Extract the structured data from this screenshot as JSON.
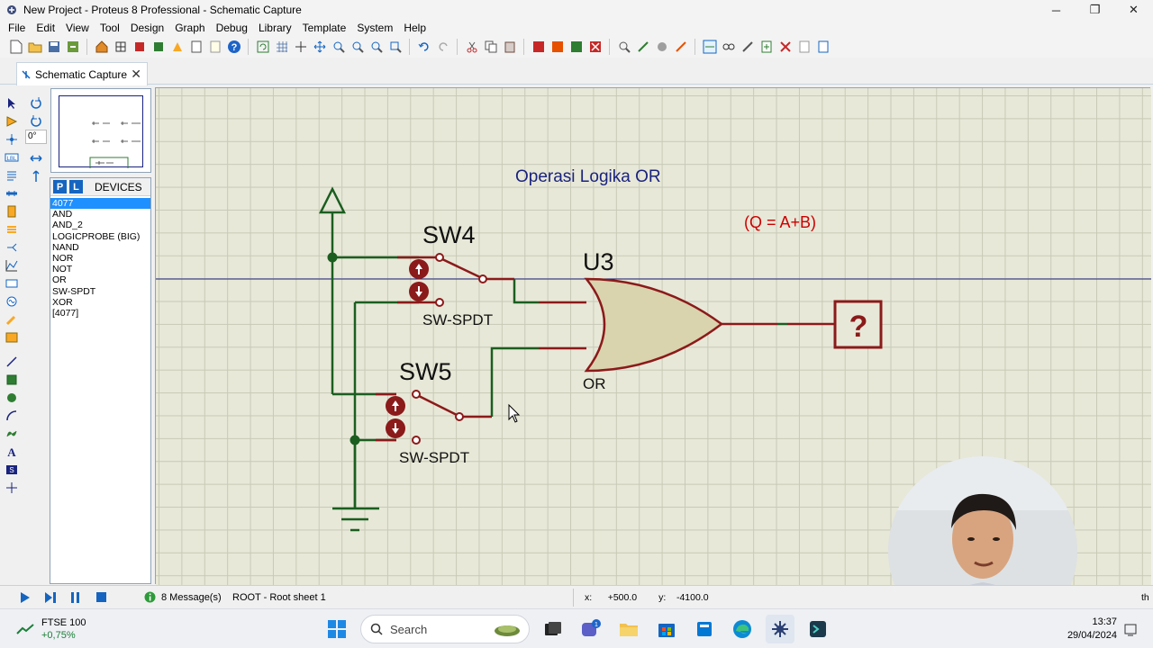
{
  "window": {
    "title": "New Project - Proteus 8 Professional - Schematic Capture",
    "minimize": "─",
    "maximize": "❐",
    "close": "✕"
  },
  "menu": [
    "File",
    "Edit",
    "View",
    "Tool",
    "Design",
    "Graph",
    "Debug",
    "Library",
    "Template",
    "System",
    "Help"
  ],
  "tab": {
    "label": "Schematic Capture",
    "close": "✕"
  },
  "rotation": {
    "angle": "0°"
  },
  "devices": {
    "p_label": "P",
    "l_label": "L",
    "title": "DEVICES",
    "items": [
      "4077",
      "AND",
      "AND_2",
      "LOGICPROBE (BIG)",
      "NAND",
      "NOR",
      "NOT",
      "OR",
      "SW-SPDT",
      "XOR",
      "[4077]"
    ],
    "selected_index": 0
  },
  "schematic": {
    "title": "Operasi Logika OR",
    "formula": "(Q = A+B)",
    "sw4_ref": "SW4",
    "sw4_type": "SW-SPDT",
    "sw5_ref": "SW5",
    "sw5_type": "SW-SPDT",
    "gate_ref": "U3",
    "gate_type": "OR",
    "probe_value": "?",
    "colors": {
      "wire_green": "#1b5e20",
      "wire_red": "#8b1a1a",
      "gate_fill": "#d9d3ae",
      "gate_stroke": "#8b1a1a",
      "title_color": "#1a237e",
      "formula_color": "#cc0000"
    }
  },
  "status": {
    "messages": "8 Message(s)",
    "sheet": "ROOT - Root sheet 1",
    "x_label": "x:",
    "x_value": "+500.0",
    "y_label": "y:",
    "y_value": "-4100.0",
    "trailing": "th"
  },
  "taskbar": {
    "stock_name": "FTSE 100",
    "stock_change": "+0,75%",
    "search_placeholder": "Search",
    "time": "13:37",
    "date": "29/04/2024"
  }
}
